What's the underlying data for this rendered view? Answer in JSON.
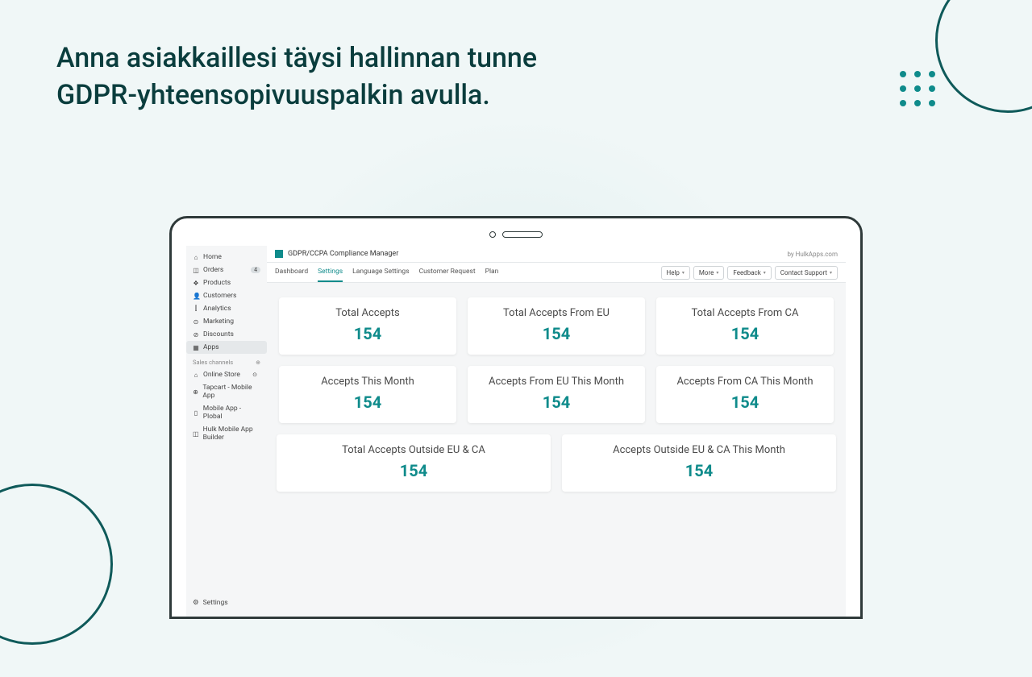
{
  "headline_line1": "Anna asiakkaillesi täysi hallinnan tunne",
  "headline_line2": "GDPR-yhteensopivuuspalkin avulla.",
  "app": {
    "title": "GDPR/CCPA Compliance Manager",
    "by": "by HulkApps.com"
  },
  "sidebar": {
    "items": [
      {
        "icon": "⌂",
        "label": "Home"
      },
      {
        "icon": "◫",
        "label": "Orders",
        "badge": "4"
      },
      {
        "icon": "❖",
        "label": "Products"
      },
      {
        "icon": "👤",
        "label": "Customers"
      },
      {
        "icon": "⫿",
        "label": "Analytics"
      },
      {
        "icon": "⊙",
        "label": "Marketing"
      },
      {
        "icon": "⊘",
        "label": "Discounts"
      },
      {
        "icon": "▦",
        "label": "Apps"
      }
    ],
    "channels_label": "Sales channels",
    "channels": [
      {
        "icon": "⌂",
        "label": "Online Store"
      },
      {
        "icon": "⊕",
        "label": "Tapcart - Mobile App"
      },
      {
        "icon": "▯",
        "label": "Mobile App - Plobal"
      },
      {
        "icon": "◫",
        "label": "Hulk Mobile App Builder"
      }
    ],
    "settings": "Settings"
  },
  "tabs": [
    "Dashboard",
    "Settings",
    "Language Settings",
    "Customer Request",
    "Plan"
  ],
  "active_tab": 1,
  "buttons": {
    "help": "Help",
    "more": "More",
    "feedback": "Feedback",
    "contact": "Contact Support"
  },
  "cards": {
    "row1": [
      {
        "label": "Total Accepts",
        "value": "154"
      },
      {
        "label": "Total Accepts From EU",
        "value": "154"
      },
      {
        "label": "Total Accepts From CA",
        "value": "154"
      }
    ],
    "row2": [
      {
        "label": "Accepts This Month",
        "value": "154"
      },
      {
        "label": "Accepts From EU This Month",
        "value": "154"
      },
      {
        "label": "Accepts From CA This Month",
        "value": "154"
      }
    ],
    "row3": [
      {
        "label": "Total Accepts Outside EU & CA",
        "value": "154"
      },
      {
        "label": "Accepts Outside EU & CA This Month",
        "value": "154"
      }
    ]
  }
}
